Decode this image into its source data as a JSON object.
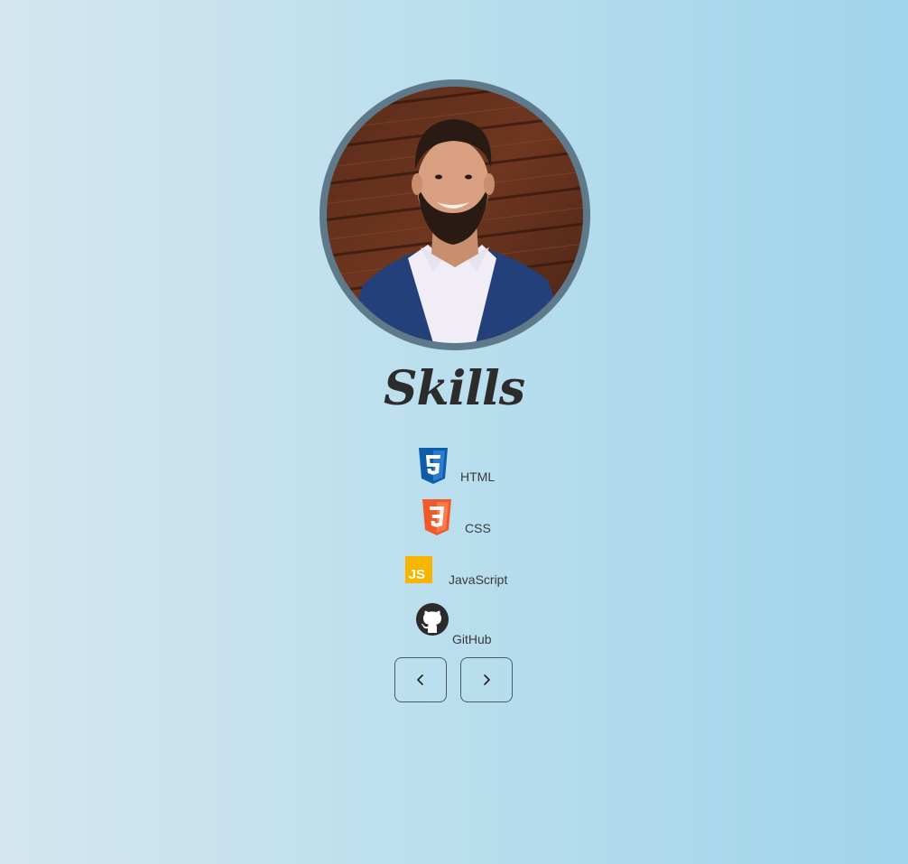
{
  "profile": {
    "photo_alt": "Profile photo",
    "border_color": "#5e7989"
  },
  "section": {
    "title": "Skills"
  },
  "skills": [
    {
      "label": "HTML",
      "icon": "html5-icon",
      "color": "#0f5ca8"
    },
    {
      "label": "CSS",
      "icon": "css3-icon",
      "color": "#f05a2b"
    },
    {
      "label": "JavaScript",
      "icon": "javascript-icon",
      "color": "#f7b500"
    },
    {
      "label": "GitHub",
      "icon": "github-icon",
      "color": "#2b2b2b"
    }
  ],
  "navigation": {
    "prev_icon": "chevron-left-icon",
    "next_icon": "chevron-right-icon"
  }
}
